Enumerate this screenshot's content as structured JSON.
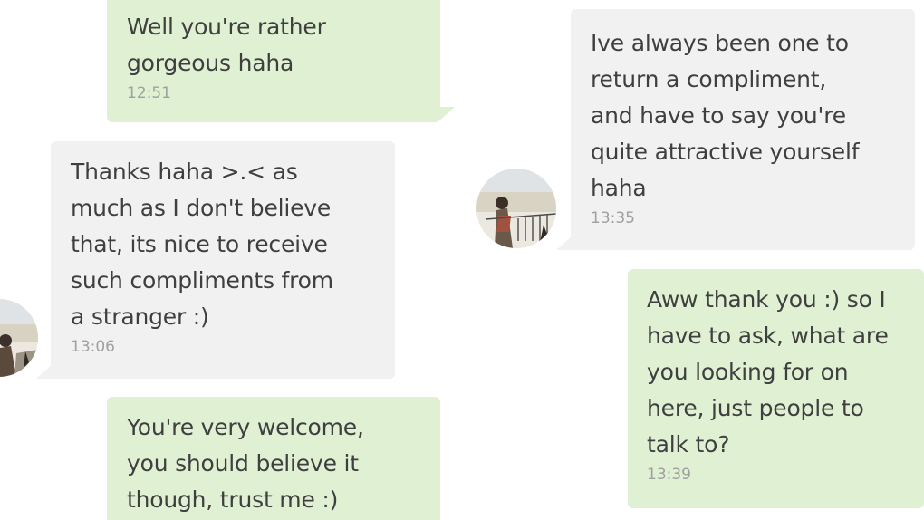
{
  "left_column": {
    "messages": [
      {
        "direction": "sent",
        "text": "Well you're rather\ngorgeous haha",
        "time": "12:51"
      },
      {
        "direction": "received",
        "text": "Thanks haha >.< as\nmuch as I don't believe\nthat, its nice to receive\nsuch compliments from\na stranger :)",
        "time": "13:06"
      },
      {
        "direction": "sent",
        "text": "You're very welcome,\nyou should believe it\nthough, trust me :)",
        "time": ""
      }
    ]
  },
  "right_column": {
    "messages": [
      {
        "direction": "received",
        "text": "Ive always been one to\nreturn a compliment,\nand have to say you're\nquite attractive yourself\nhaha",
        "time": "13:35"
      },
      {
        "direction": "sent",
        "text": "Aww thank you :) so I\nhave to ask, what are\nyou looking for on\nhere, just people to\ntalk to?",
        "time": "13:39"
      }
    ]
  },
  "colors": {
    "sent_bubble": "#dff0d3",
    "received_bubble": "#f1f1f2",
    "message_text": "#3f3f3f",
    "timestamp_text": "#a0a0a0"
  },
  "icons": {
    "contact_avatar": "avatar-photo-icon"
  }
}
